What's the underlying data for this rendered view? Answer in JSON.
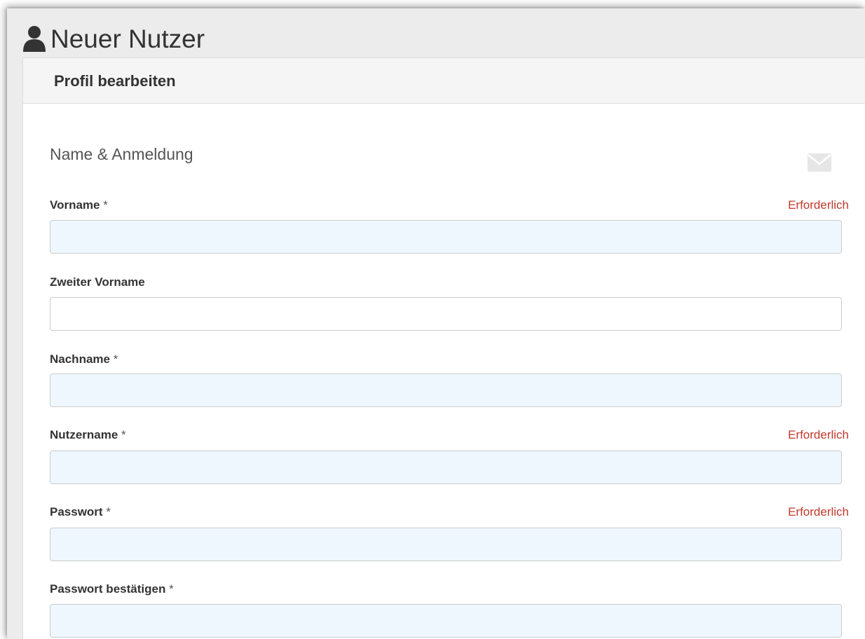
{
  "page": {
    "title": "Neuer Nutzer",
    "icon": "user-icon"
  },
  "panel": {
    "title": "Profil bearbeiten"
  },
  "section": {
    "title": "Name & Anmeldung",
    "icon": "envelope-icon"
  },
  "colors": {
    "error_text": "#c0392b",
    "required_input_bg": "#eef7fd",
    "page_bg": "#ececec"
  },
  "fields": {
    "firstname": {
      "label": "Vorname",
      "required_mark": "*",
      "error": "Erforderlich",
      "value": ""
    },
    "middlename": {
      "label": "Zweiter Vorname",
      "value": ""
    },
    "lastname": {
      "label": "Nachname",
      "required_mark": "*",
      "value": ""
    },
    "username": {
      "label": "Nutzername",
      "required_mark": "*",
      "error": "Erforderlich",
      "value": ""
    },
    "password": {
      "label": "Passwort",
      "required_mark": "*",
      "error": "Erforderlich",
      "value": ""
    },
    "password_confirm": {
      "label": "Passwort bestätigen",
      "required_mark": "*",
      "value": ""
    }
  }
}
